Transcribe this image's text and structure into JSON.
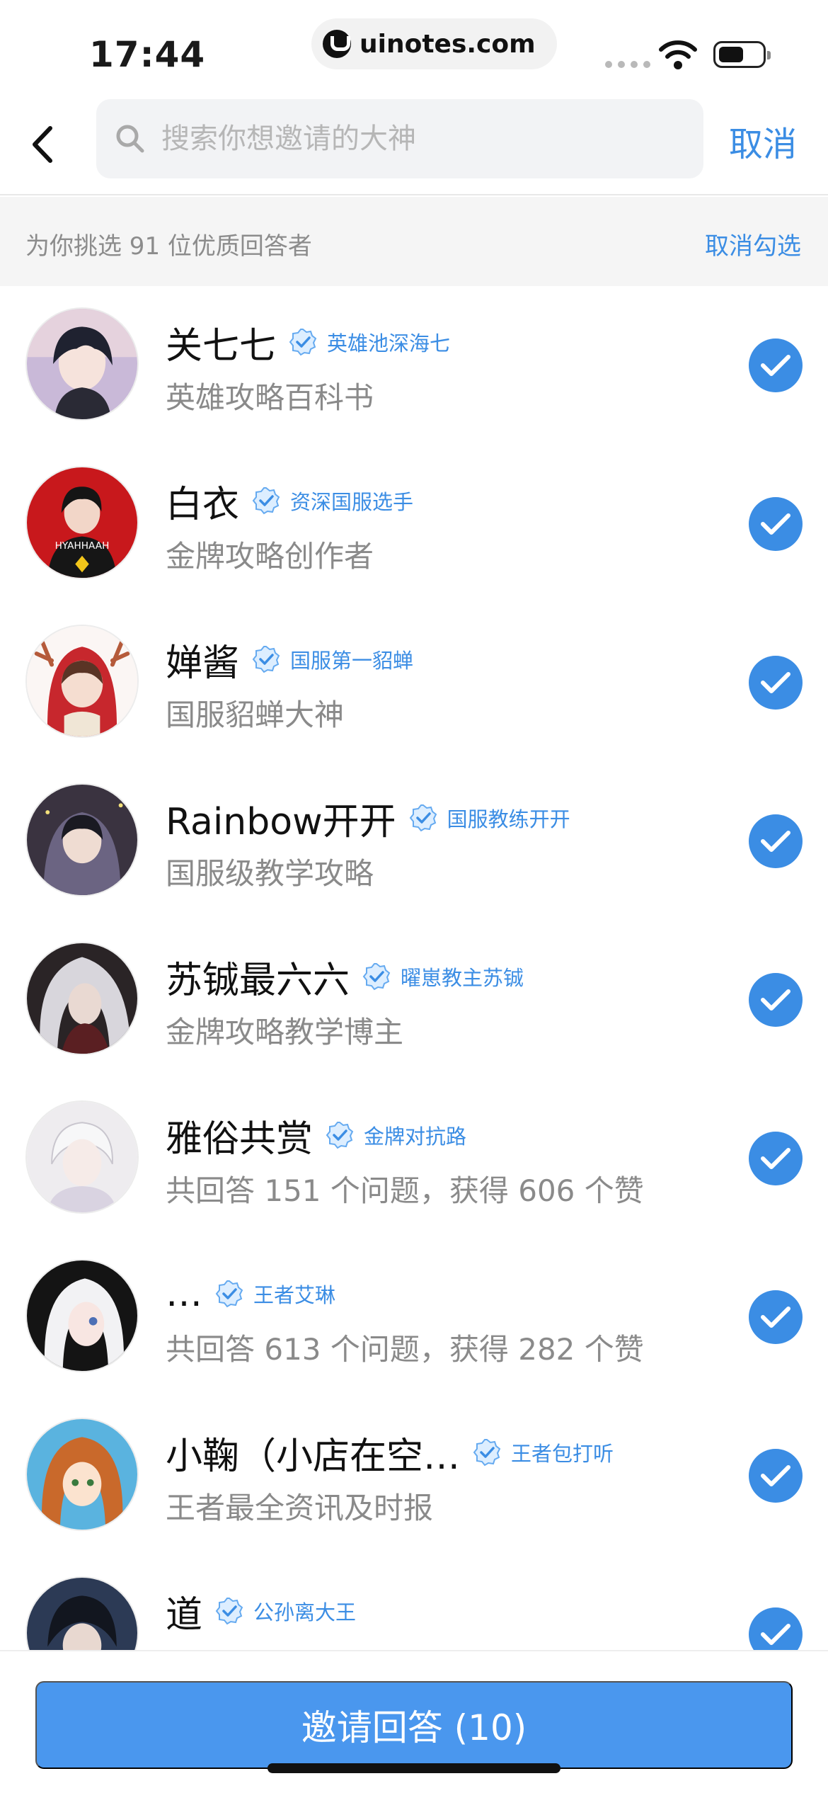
{
  "status_bar": {
    "time": "17:44",
    "url": "uinotes.com"
  },
  "header": {
    "back_icon": "chevron-left-icon",
    "search_icon": "search-icon",
    "search_placeholder": "搜索你想邀请的大神",
    "search_value": "",
    "cancel_label": "取消"
  },
  "section": {
    "summary": "为你挑选 91 位优质回答者",
    "uncheck_all_label": "取消勾选"
  },
  "colors": {
    "accent": "#3b8de4",
    "button": "#4a97ee"
  },
  "experts": [
    {
      "name": "关七七",
      "tag": "英雄池深海七",
      "desc": "英雄攻略百科书",
      "checked": true,
      "avatar": "anime-boy-black-hair-avatar"
    },
    {
      "name": "白衣",
      "tag": "资深国服选手",
      "desc": "金牌攻略创作者",
      "checked": true,
      "avatar": "boy-red-background-avatar"
    },
    {
      "name": "婵酱",
      "tag": "国服第一貂蝉",
      "desc": "国服貂蝉大神",
      "checked": true,
      "avatar": "girl-reindeer-hood-avatar"
    },
    {
      "name": "Rainbow开开",
      "tag": "国服教练开开",
      "desc": "国服级教学攻略",
      "checked": true,
      "avatar": "boy-purple-hoodie-avatar"
    },
    {
      "name": "苏铖最六六",
      "tag": "曜崽教主苏铖",
      "desc": "金牌攻略教学博主",
      "checked": true,
      "avatar": "white-hair-warrior-avatar"
    },
    {
      "name": "雅俗共赏",
      "tag": "金牌对抗路",
      "desc": "共回答 151 个问题，获得 606 个赞",
      "checked": true,
      "avatar": "pale-boy-sketch-avatar"
    },
    {
      "name": "…",
      "tag": "王者艾琳",
      "desc": "共回答 613 个问题，获得 282 个赞",
      "checked": true,
      "avatar": "white-hair-girl-avatar"
    },
    {
      "name": "小鞠（小店在空…",
      "tag": "王者包打听",
      "desc": "王者最全资讯及时报",
      "checked": true,
      "avatar": "orange-hair-girl-avatar"
    },
    {
      "name": "道",
      "tag": "公孙离大王",
      "desc": "",
      "checked": true,
      "avatar": "dark-hair-boy-avatar"
    }
  ],
  "footer": {
    "invite_label": "邀请回答 (10)"
  }
}
